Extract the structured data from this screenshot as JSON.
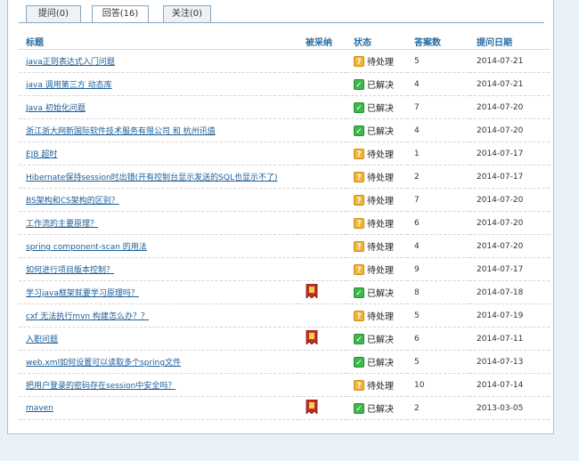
{
  "tabs": [
    {
      "label": "提问(0)",
      "active": false
    },
    {
      "label": "回答(16)",
      "active": true
    },
    {
      "label": "关注(0)",
      "active": false
    }
  ],
  "table": {
    "headers": {
      "title": "标题",
      "adopted": "被采纳",
      "status": "状态",
      "answers": "答案数",
      "date": "提问日期"
    },
    "rows": [
      {
        "title": "java正则表达式入门问题",
        "adopted": false,
        "status": "待处理",
        "status_type": "pending",
        "answers": "5",
        "date": "2014-07-21"
      },
      {
        "title": "java 调用第三方 动态库",
        "adopted": false,
        "status": "已解决",
        "status_type": "solved",
        "answers": "4",
        "date": "2014-07-21"
      },
      {
        "title": "Java 初始化问题",
        "adopted": false,
        "status": "已解决",
        "status_type": "solved",
        "answers": "7",
        "date": "2014-07-20"
      },
      {
        "title": "浙江浙大网新国际软件技术服务有限公司 和 杭州讯值",
        "adopted": false,
        "status": "已解决",
        "status_type": "solved",
        "answers": "4",
        "date": "2014-07-20"
      },
      {
        "title": "EJB 超时",
        "adopted": false,
        "status": "待处理",
        "status_type": "pending",
        "answers": "1",
        "date": "2014-07-17"
      },
      {
        "title": "Hibernate保持session时出错(开有控制台显示发送的SQL也显示不了)",
        "adopted": false,
        "status": "待处理",
        "status_type": "pending",
        "answers": "2",
        "date": "2014-07-17"
      },
      {
        "title": "BS架构和CS架构的区别？",
        "adopted": false,
        "status": "待处理",
        "status_type": "pending",
        "answers": "7",
        "date": "2014-07-20"
      },
      {
        "title": "工作流的主要原理？",
        "adopted": false,
        "status": "待处理",
        "status_type": "pending",
        "answers": "6",
        "date": "2014-07-20"
      },
      {
        "title": "spring component-scan 的用法",
        "adopted": false,
        "status": "待处理",
        "status_type": "pending",
        "answers": "4",
        "date": "2014-07-20"
      },
      {
        "title": "如何进行项目版本控制？",
        "adopted": false,
        "status": "待处理",
        "status_type": "pending",
        "answers": "9",
        "date": "2014-07-17"
      },
      {
        "title": "学习java框架就要学习原理吗？",
        "adopted": true,
        "status": "已解决",
        "status_type": "solved",
        "answers": "8",
        "date": "2014-07-18"
      },
      {
        "title": "cxf 无法执行mvn 构建怎么办？？",
        "adopted": false,
        "status": "待处理",
        "status_type": "pending",
        "answers": "5",
        "date": "2014-07-19"
      },
      {
        "title": "入职问题",
        "adopted": true,
        "status": "已解决",
        "status_type": "solved",
        "answers": "6",
        "date": "2014-07-11"
      },
      {
        "title": "web.xml如何设置可以读取多个spring文件",
        "adopted": false,
        "status": "已解决",
        "status_type": "solved",
        "answers": "5",
        "date": "2014-07-13"
      },
      {
        "title": "把用户登录的密码存在session中安全吗？",
        "adopted": false,
        "status": "待处理",
        "status_type": "pending",
        "answers": "10",
        "date": "2014-07-14"
      },
      {
        "title": "maven",
        "adopted": true,
        "status": "已解决",
        "status_type": "solved",
        "answers": "2",
        "date": "2013-03-05"
      }
    ]
  },
  "colors": {
    "link": "#1a5d97",
    "header": "#2a6ea3",
    "pending": "#f0b43a",
    "solved": "#3fb84b",
    "adopted_badge": "#c0302a"
  },
  "icons": {
    "pending": "pending-status-icon",
    "solved": "check-status-icon",
    "adopted": "adopted-ribbon-icon"
  }
}
